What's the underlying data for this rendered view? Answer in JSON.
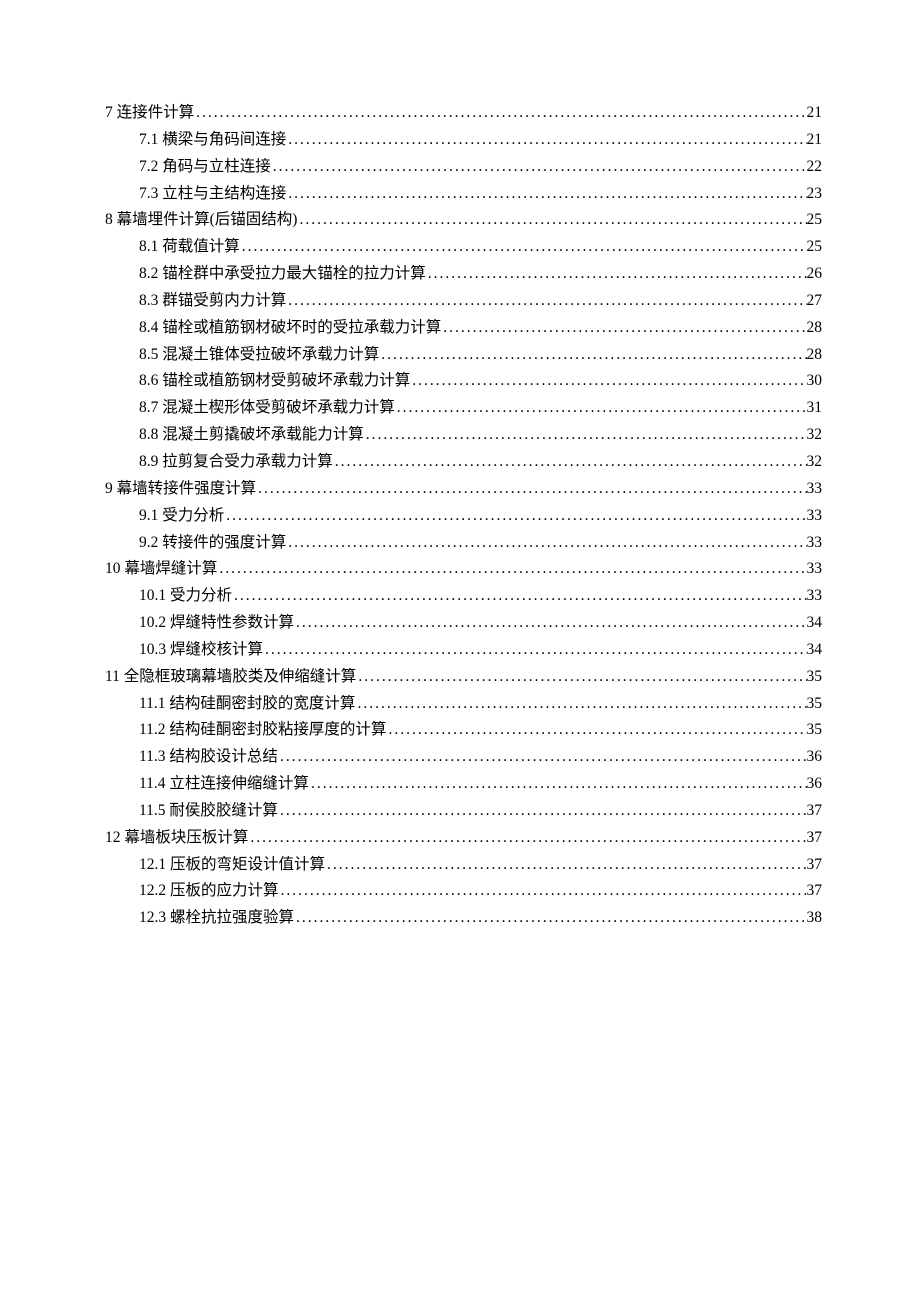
{
  "toc": [
    {
      "level": 1,
      "label": "7  连接件计算",
      "page": "21"
    },
    {
      "level": 2,
      "label": "7.1  横梁与角码间连接",
      "page": "21"
    },
    {
      "level": 2,
      "label": "7.2  角码与立柱连接",
      "page": "22"
    },
    {
      "level": 2,
      "label": "7.3  立柱与主结构连接",
      "page": "23"
    },
    {
      "level": 1,
      "label": "8  幕墙埋件计算(后锚固结构)",
      "page": "25"
    },
    {
      "level": 2,
      "label": "8.1  荷载值计算",
      "page": "25"
    },
    {
      "level": 2,
      "label": "8.2  锚栓群中承受拉力最大锚栓的拉力计算",
      "page": "26"
    },
    {
      "level": 2,
      "label": "8.3  群锚受剪内力计算",
      "page": "27"
    },
    {
      "level": 2,
      "label": "8.4  锚栓或植筋钢材破坏时的受拉承载力计算",
      "page": "28"
    },
    {
      "level": 2,
      "label": "8.5  混凝土锥体受拉破坏承载力计算",
      "page": "28"
    },
    {
      "level": 2,
      "label": "8.6  锚栓或植筋钢材受剪破坏承载力计算",
      "page": "30"
    },
    {
      "level": 2,
      "label": "8.7  混凝土楔形体受剪破坏承载力计算",
      "page": "31"
    },
    {
      "level": 2,
      "label": "8.8  混凝土剪撬破坏承载能力计算",
      "page": "32"
    },
    {
      "level": 2,
      "label": "8.9  拉剪复合受力承载力计算",
      "page": "32"
    },
    {
      "level": 1,
      "label": "9  幕墙转接件强度计算",
      "page": "33"
    },
    {
      "level": 2,
      "label": "9.1  受力分析",
      "page": "33"
    },
    {
      "level": 2,
      "label": "9.2  转接件的强度计算",
      "page": "33"
    },
    {
      "level": 1,
      "label": "10  幕墙焊缝计算",
      "page": "33"
    },
    {
      "level": 2,
      "label": "10.1  受力分析",
      "page": "33"
    },
    {
      "level": 2,
      "label": "10.2  焊缝特性参数计算",
      "page": "34"
    },
    {
      "level": 2,
      "label": "10.3  焊缝校核计算",
      "page": "34"
    },
    {
      "level": 1,
      "label": "11  全隐框玻璃幕墙胶类及伸缩缝计算",
      "page": "35"
    },
    {
      "level": 2,
      "label": "11.1  结构硅酮密封胶的宽度计算",
      "page": "35"
    },
    {
      "level": 2,
      "label": "11.2  结构硅酮密封胶粘接厚度的计算",
      "page": "35"
    },
    {
      "level": 2,
      "label": "11.3  结构胶设计总结",
      "page": "36"
    },
    {
      "level": 2,
      "label": "11.4  立柱连接伸缩缝计算",
      "page": "36"
    },
    {
      "level": 2,
      "label": "11.5  耐侯胶胶缝计算",
      "page": "37"
    },
    {
      "level": 1,
      "label": "12  幕墙板块压板计算",
      "page": "37"
    },
    {
      "level": 2,
      "label": "12.1  压板的弯矩设计值计算",
      "page": "37"
    },
    {
      "level": 2,
      "label": "12.2  压板的应力计算",
      "page": "37"
    },
    {
      "level": 2,
      "label": "12.3  螺栓抗拉强度验算",
      "page": "38"
    }
  ]
}
